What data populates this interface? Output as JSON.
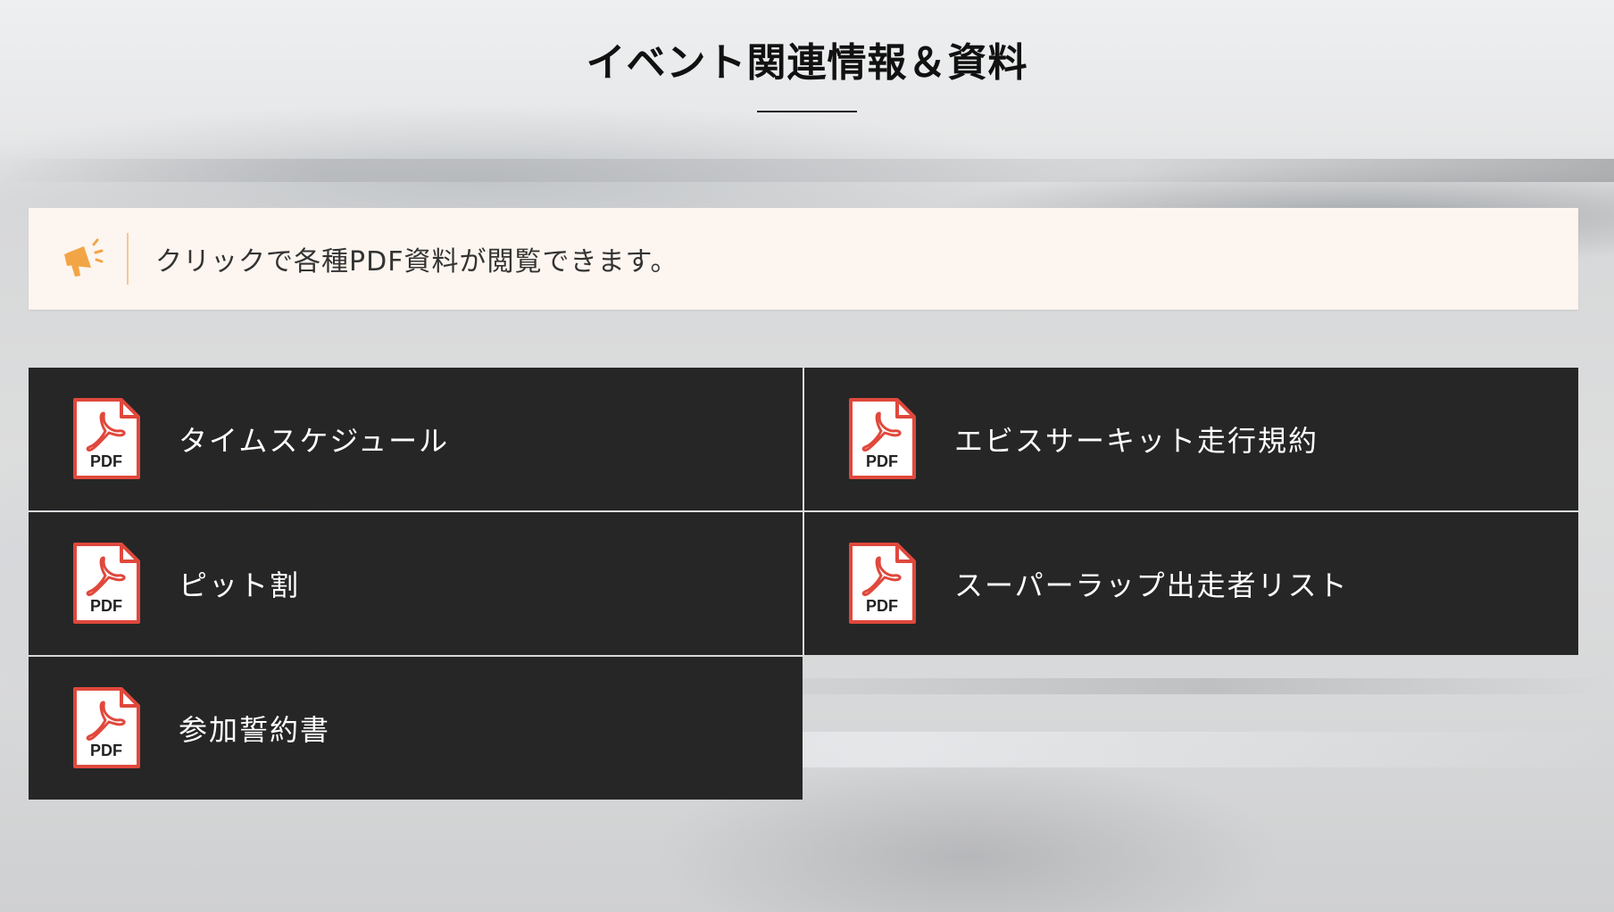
{
  "header": {
    "title": "イベント関連情報＆資料"
  },
  "notice": {
    "icon": "megaphone-icon",
    "text": "クリックで各種PDF資料が閲覧できます。",
    "accent_color": "#f2a545"
  },
  "documents": {
    "icon": "pdf-file-icon",
    "icon_label": "PDF",
    "items": [
      {
        "label": "タイムスケジュール"
      },
      {
        "label": "エビスサーキット走行規約"
      },
      {
        "label": "ピット割"
      },
      {
        "label": "スーパーラップ出走者リスト"
      },
      {
        "label": "参加誓約書"
      }
    ]
  },
  "colors": {
    "tile_background": "#262626",
    "pdf_red": "#e0483c",
    "notice_background": "#fdf5ef"
  }
}
